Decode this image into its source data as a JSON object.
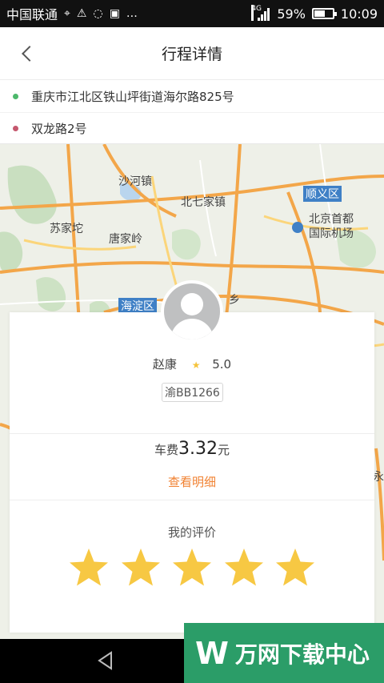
{
  "status_bar": {
    "carrier": "中国联通",
    "network": "4G",
    "battery": "59%",
    "time": "10:09",
    "battery_level": 0.59
  },
  "header": {
    "title": "行程详情"
  },
  "route": {
    "origin": "重庆市江北区铁山坪街道海尔路825号",
    "destination": "双龙路2号",
    "origin_color": "#4cb86b",
    "destination_color": "#c5586e"
  },
  "map": {
    "labels": [
      "沙河镇",
      "北七家镇",
      "顺义区",
      "苏家坨",
      "唐家岭",
      "北京首都国际机场",
      "海淀区",
      "乡",
      "永"
    ]
  },
  "driver": {
    "name": "赵康",
    "rating": "5.0",
    "plate": "渝BB1266"
  },
  "fare": {
    "label": "车费",
    "amount": "3.32",
    "unit": "元",
    "detail_link": "查看明细"
  },
  "rating": {
    "label": "我的评价",
    "stars": 5,
    "max_stars": 5,
    "star_color": "#f7c843"
  },
  "watermark": {
    "text": "万网下载中心"
  }
}
